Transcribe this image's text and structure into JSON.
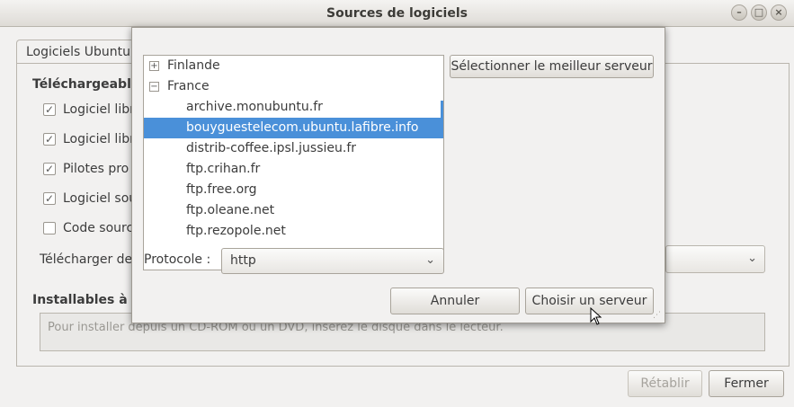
{
  "window": {
    "title": "Sources de logiciels",
    "controls": {
      "close": "×",
      "minimize": "–",
      "maximize": "□"
    }
  },
  "tabs": [
    {
      "label": "Logiciels Ubuntu"
    }
  ],
  "background": {
    "downloadable_title": "Téléchargeable",
    "checkboxes": [
      {
        "label": "Logiciel libr",
        "checked": true
      },
      {
        "label": "Logiciel libr",
        "checked": true
      },
      {
        "label": "Pilotes pro",
        "checked": true
      },
      {
        "label": "Logiciel sou",
        "checked": true
      },
      {
        "label": "Code sourc",
        "checked": false
      }
    ],
    "download_from_label": "Télécharger de",
    "installable_title": "Installables à p",
    "cdrom_text": "Pour installer depuis un CD-ROM ou un DVD, insérez le disque dans le lecteur."
  },
  "footer": {
    "revert_label": "Rétablir",
    "close_label": "Fermer"
  },
  "dialog": {
    "best_server_button": "Sélectionner le meilleur serveur",
    "mirrors": [
      {
        "type": "group",
        "label": "Finlande",
        "expanded": false
      },
      {
        "type": "group",
        "label": "France",
        "expanded": true
      },
      {
        "type": "child",
        "label": "archive.monubuntu.fr",
        "selected": false
      },
      {
        "type": "child",
        "label": "bouyguestelecom.ubuntu.lafibre.info",
        "selected": true
      },
      {
        "type": "child",
        "label": "distrib-coffee.ipsl.jussieu.fr",
        "selected": false
      },
      {
        "type": "child",
        "label": "ftp.crihan.fr",
        "selected": false
      },
      {
        "type": "child",
        "label": "ftp.free.org",
        "selected": false
      },
      {
        "type": "child",
        "label": "ftp.oleane.net",
        "selected": false
      },
      {
        "type": "child",
        "label": "ftp.rezopole.net",
        "selected": false
      }
    ],
    "protocol_label": "Protocole :",
    "protocol_value": "http",
    "cancel_label": "Annuler",
    "choose_label": "Choisir un serveur"
  },
  "colors": {
    "selection": "#4a90d9",
    "window_bg": "#f2f1f0"
  },
  "icons": {
    "dropdown": "chevron-down-icon",
    "expand": "plus-icon",
    "collapse": "minus-icon"
  }
}
